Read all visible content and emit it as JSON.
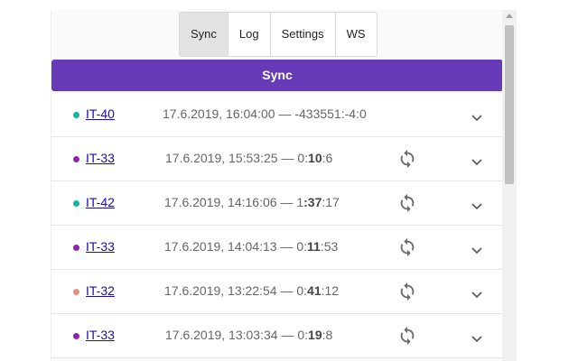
{
  "tabs": [
    {
      "label": "Sync",
      "active": true
    },
    {
      "label": "Log",
      "active": false
    },
    {
      "label": "Settings",
      "active": false
    },
    {
      "label": "WS",
      "active": false
    }
  ],
  "sync_bar": {
    "label": "Sync"
  },
  "rows": [
    {
      "id": "IT-40",
      "dot_color": "#11b5a0",
      "date": "17.6.2019, 16:04:00 — ",
      "h": "",
      "m": "-433551:",
      "s": "-4:0",
      "has_sync": false
    },
    {
      "id": "IT-33",
      "dot_color": "#8e24aa",
      "date": "17.6.2019, 15:53:25 — ",
      "h": "0:",
      "m": "10",
      "s": ":6",
      "has_sync": true
    },
    {
      "id": "IT-42",
      "dot_color": "#11b5a0",
      "date": "17.6.2019, 14:16:06 — ",
      "h": "1",
      "m": ":37",
      "s": ":17",
      "has_sync": true
    },
    {
      "id": "IT-33",
      "dot_color": "#8e24aa",
      "date": "17.6.2019, 14:04:13 — ",
      "h": "0:",
      "m": "11",
      "s": ":53",
      "has_sync": true
    },
    {
      "id": "IT-32",
      "dot_color": "#e0937a",
      "date": "17.6.2019, 13:22:54 — ",
      "h": "0:",
      "m": "41",
      "s": ":12",
      "has_sync": true
    },
    {
      "id": "IT-33",
      "dot_color": "#8e24aa",
      "date": "17.6.2019, 13:03:34 — ",
      "h": "0:",
      "m": "19",
      "s": ":8",
      "has_sync": true
    }
  ],
  "colors": {
    "accent": "#673ab7"
  },
  "icons": {
    "sync": "sync-icon",
    "expand": "chevron-down-icon"
  }
}
